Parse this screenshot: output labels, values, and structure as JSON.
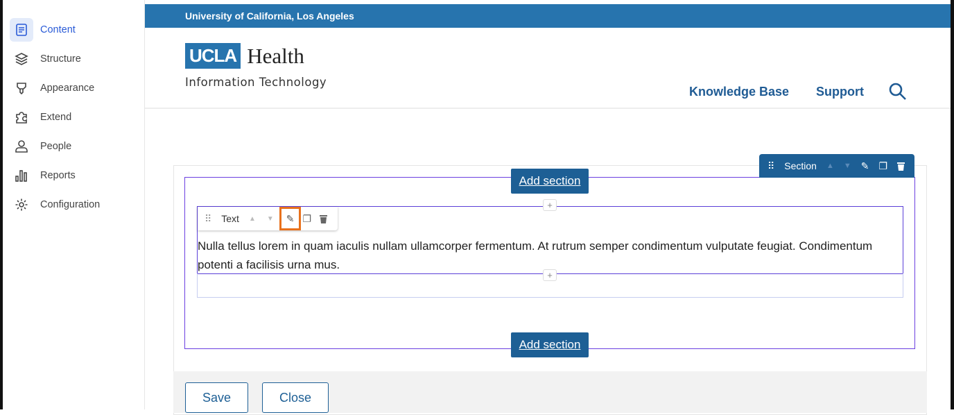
{
  "sidebar": {
    "items": [
      {
        "label": "Content",
        "icon": "content-icon",
        "active": true
      },
      {
        "label": "Structure",
        "icon": "layers-icon"
      },
      {
        "label": "Appearance",
        "icon": "brush-icon"
      },
      {
        "label": "Extend",
        "icon": "puzzle-icon"
      },
      {
        "label": "People",
        "icon": "person-icon"
      },
      {
        "label": "Reports",
        "icon": "bar-chart-icon"
      },
      {
        "label": "Configuration",
        "icon": "gear-icon"
      }
    ]
  },
  "site": {
    "topbar": "University of California, Los Angeles",
    "logo_ucla": "UCLA",
    "logo_health": "Health",
    "subtitle": "Information Technology",
    "nav": [
      "Knowledge Base",
      "Support"
    ]
  },
  "layout": {
    "add_section": "Add section",
    "section_label": "Section",
    "block_label": "Text",
    "block_text": "Nulla tellus lorem in quam iaculis nullam ullamcorper fermentum. At rutrum semper condimentum vulputate feugiat. Condimentum potenti a facilisis urna mus.",
    "plus": "+"
  },
  "actions": {
    "save": "Save",
    "close": "Close"
  },
  "colors": {
    "brand": "#2774ae",
    "toolbar": "#1d5f95",
    "section_outline": "#6b3fe0",
    "highlight": "#e8711c"
  }
}
